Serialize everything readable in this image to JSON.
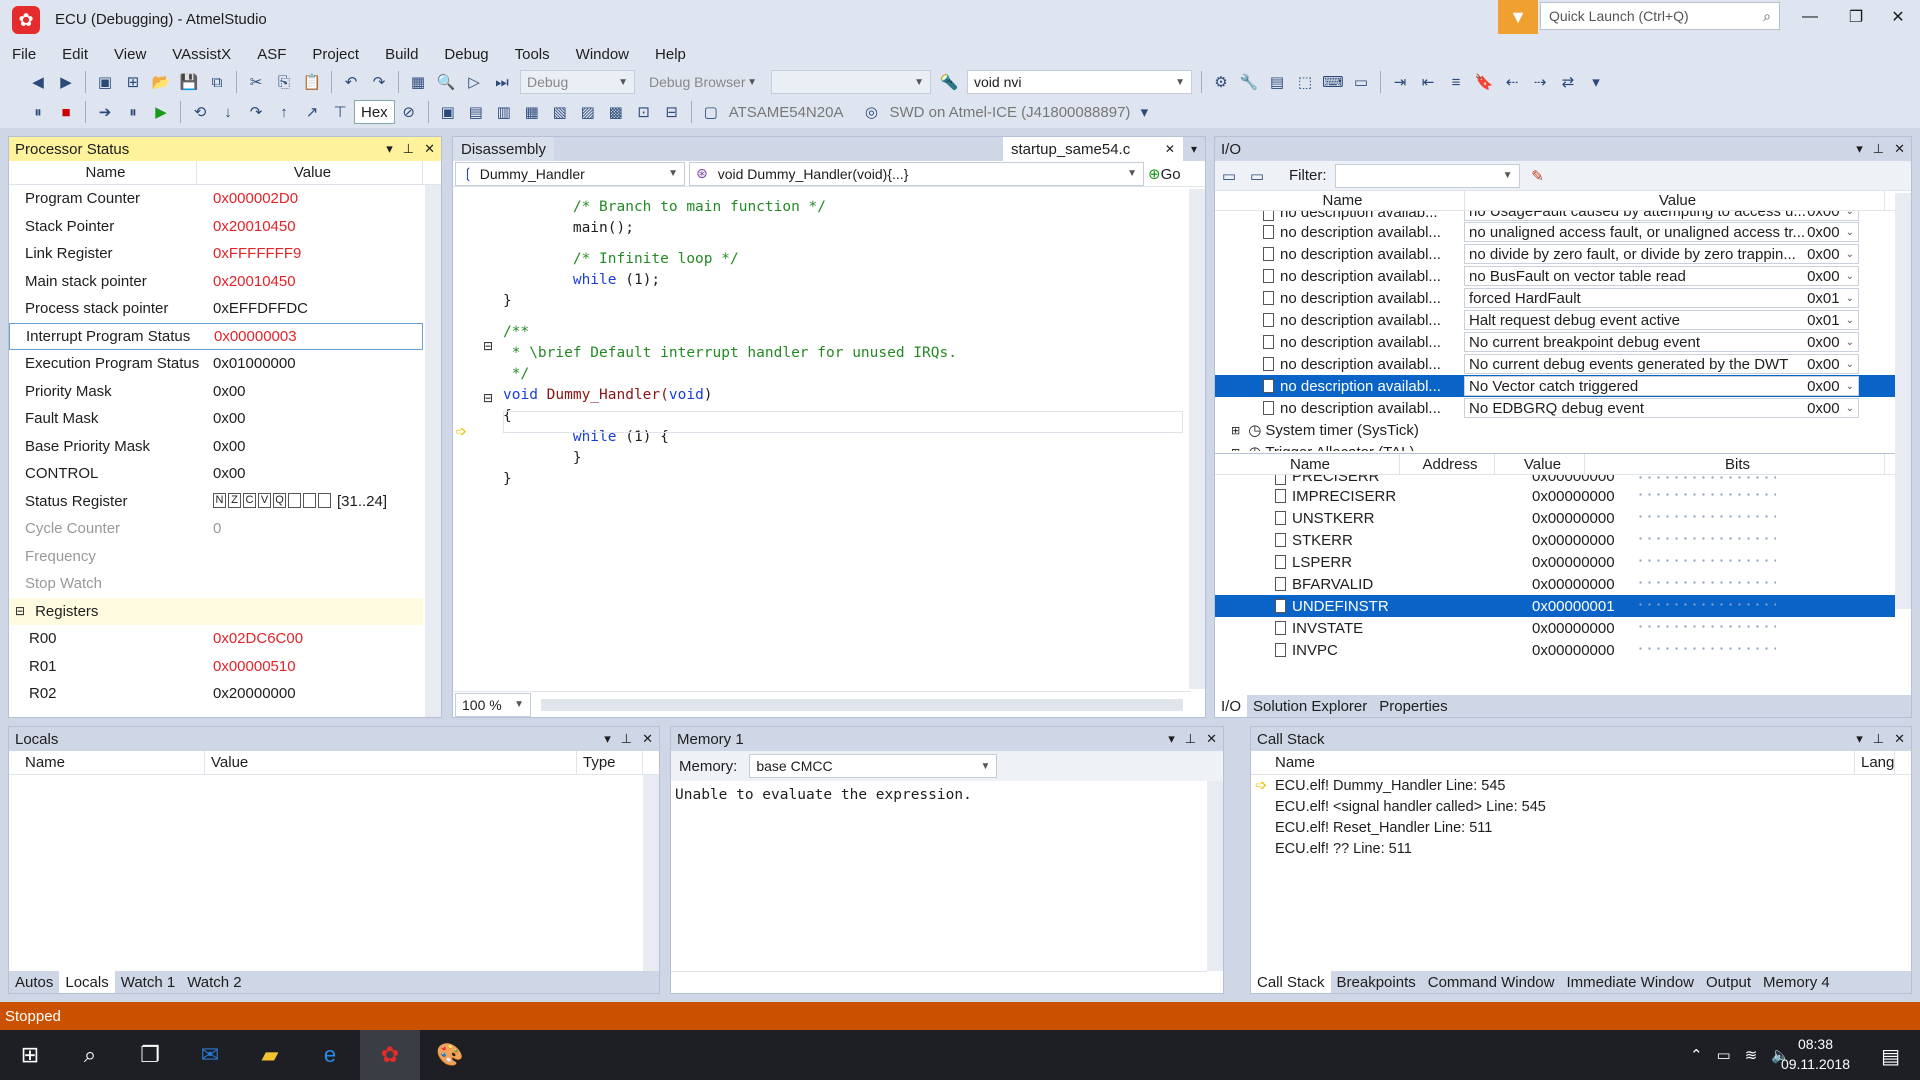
{
  "window": {
    "title": "ECU (Debugging) - AtmelStudio",
    "quick_launch": "Quick Launch (Ctrl+Q)"
  },
  "menu": [
    "File",
    "Edit",
    "View",
    "VAssistX",
    "ASF",
    "Project",
    "Build",
    "Debug",
    "Tools",
    "Window",
    "Help"
  ],
  "toolbar": {
    "config": "Debug",
    "debug_browser": "Debug Browser",
    "search_value": "void nvi",
    "hex": "Hex",
    "device": "ATSAME54N20A",
    "tool": "SWD on Atmel-ICE (J41800088897)"
  },
  "processor_status": {
    "title": "Processor Status",
    "col_name": "Name",
    "col_value": "Value",
    "rows": [
      {
        "name": "Program Counter",
        "value": "0x000002D0",
        "changed": true
      },
      {
        "name": "Stack Pointer",
        "value": "0x20010450",
        "changed": true
      },
      {
        "name": "Link Register",
        "value": "0xFFFFFFF9",
        "changed": true
      },
      {
        "name": "Main stack pointer",
        "value": "0x20010450",
        "changed": true
      },
      {
        "name": "Process stack pointer",
        "value": "0xEFFDFFDC",
        "changed": false
      },
      {
        "name": "Interrupt Program Status",
        "value": "0x00000003",
        "changed": true
      },
      {
        "name": "Execution Program Status",
        "value": "0x01000000",
        "changed": false
      },
      {
        "name": "Priority Mask",
        "value": "0x00",
        "changed": false
      },
      {
        "name": "Fault Mask",
        "value": "0x00",
        "changed": false
      },
      {
        "name": "Base Priority Mask",
        "value": "0x00",
        "changed": false
      },
      {
        "name": "CONTROL",
        "value": "0x00",
        "changed": false
      }
    ],
    "status_register": {
      "name": "Status Register",
      "flags": [
        "N",
        "Z",
        "C",
        "V",
        "Q",
        "",
        "",
        ""
      ],
      "range": "[31..24]"
    },
    "disabled": [
      {
        "name": "Cycle Counter",
        "value": "0"
      },
      {
        "name": "Frequency",
        "value": ""
      },
      {
        "name": "Stop Watch",
        "value": ""
      }
    ],
    "registers_label": "Registers",
    "registers": [
      {
        "name": "R00",
        "value": "0x02DC6C00",
        "changed": true
      },
      {
        "name": "R01",
        "value": "0x00000510",
        "changed": true
      },
      {
        "name": "R02",
        "value": "0x20000000",
        "changed": false
      }
    ]
  },
  "editor": {
    "tab_disassembly": "Disassembly",
    "tab_file": "startup_same54.c",
    "nav_left": "Dummy_Handler",
    "nav_right": "void Dummy_Handler(void){...}",
    "go": "Go",
    "zoom": "100 %",
    "lines": [
      {
        "t": "        ",
        "c": "/* Branch to main function */",
        "k": "cm"
      },
      {
        "t": "        main();",
        "k": "plain"
      },
      {
        "t": "",
        "k": "plain"
      },
      {
        "t": "        ",
        "c": "/* Infinite loop */",
        "k": "cm"
      },
      {
        "t": "        ",
        "c": "while",
        "r": " (1);",
        "k": "kw"
      },
      {
        "t": "}",
        "k": "plain"
      },
      {
        "t": "",
        "k": "plain"
      },
      {
        "t": "",
        "c": "/**",
        "k": "cm"
      },
      {
        "t": "",
        "c": " * \\brief Default interrupt handler for unused IRQs.",
        "k": "cm"
      },
      {
        "t": "",
        "c": " */",
        "k": "cm"
      },
      {
        "t": "",
        "c": "void",
        "r": " Dummy_Handler(",
        "c2": "void",
        "r2": ")",
        "k": "sig"
      },
      {
        "t": "{",
        "k": "plain"
      },
      {
        "t": "        ",
        "c": "while",
        "r": " (1) {",
        "k": "kw"
      },
      {
        "t": "        }",
        "k": "plain"
      },
      {
        "t": "}",
        "k": "plain"
      }
    ]
  },
  "io": {
    "title": "I/O",
    "filter_label": "Filter:",
    "col_name": "Name",
    "col_value": "Value",
    "partial_row": {
      "name": "no description availab...",
      "value": "no UsageFault caused by attempting to access u...",
      "hex": "0x00"
    },
    "rows": [
      {
        "name": "no description availabl...",
        "value": "no unaligned access fault, or unaligned access tr...",
        "hex": "0x00"
      },
      {
        "name": "no description availabl...",
        "value": "no divide by zero fault, or divide by zero trappin...",
        "hex": "0x00"
      },
      {
        "name": "no description availabl...",
        "value": "no BusFault on vector table read",
        "hex": "0x00"
      },
      {
        "name": "no description availabl...",
        "value": "forced HardFault",
        "hex": "0x01"
      },
      {
        "name": "no description availabl...",
        "value": "Halt request debug event active",
        "hex": "0x01"
      },
      {
        "name": "no description availabl...",
        "value": "No current breakpoint debug event",
        "hex": "0x00"
      },
      {
        "name": "no description availabl...",
        "value": "No current debug events generated by the DWT",
        "hex": "0x00"
      },
      {
        "name": "no description availabl...",
        "value": "No Vector catch triggered",
        "hex": "0x00",
        "selected": true
      },
      {
        "name": "no description availabl...",
        "value": "No EDBGRQ debug event",
        "hex": "0x00"
      }
    ],
    "groups": [
      "System timer (SysTick)",
      "Trigger Allocator (TAL)"
    ],
    "bits_header": {
      "name": "Name",
      "address": "Address",
      "value": "Value",
      "bits": "Bits"
    },
    "bits_partial": {
      "name": "PRECISERR",
      "value": "0x00000000"
    },
    "bits_rows": [
      {
        "name": "IMPRECISERR",
        "value": "0x00000000"
      },
      {
        "name": "UNSTKERR",
        "value": "0x00000000"
      },
      {
        "name": "STKERR",
        "value": "0x00000000"
      },
      {
        "name": "LSPERR",
        "value": "0x00000000"
      },
      {
        "name": "BFARVALID",
        "value": "0x00000000"
      },
      {
        "name": "UNDEFINSTR",
        "value": "0x00000001",
        "selected": true
      },
      {
        "name": "INVSTATE",
        "value": "0x00000000"
      },
      {
        "name": "INVPC",
        "value": "0x00000000"
      }
    ],
    "tabs": [
      "I/O",
      "Solution Explorer",
      "Properties"
    ]
  },
  "locals": {
    "title": "Locals",
    "col_name": "Name",
    "col_value": "Value",
    "col_type": "Type",
    "tabs": [
      "Autos",
      "Locals",
      "Watch 1",
      "Watch 2"
    ]
  },
  "memory": {
    "title": "Memory 1",
    "label": "Memory:",
    "value": "base CMCC",
    "message": "Unable to evaluate the expression."
  },
  "callstack": {
    "title": "Call Stack",
    "col_name": "Name",
    "col_lang": "Lang",
    "rows": [
      "ECU.elf! Dummy_Handler Line: 545",
      "ECU.elf! <signal handler called> Line: 545",
      "ECU.elf! Reset_Handler Line: 511",
      "ECU.elf! ?? Line: 511"
    ],
    "tabs": [
      "Call Stack",
      "Breakpoints",
      "Command Window",
      "Immediate Window",
      "Output",
      "Memory 4"
    ]
  },
  "statusbar": {
    "text": "Stopped"
  },
  "taskbar": {
    "time": "08:38",
    "date": "09.11.2018"
  }
}
